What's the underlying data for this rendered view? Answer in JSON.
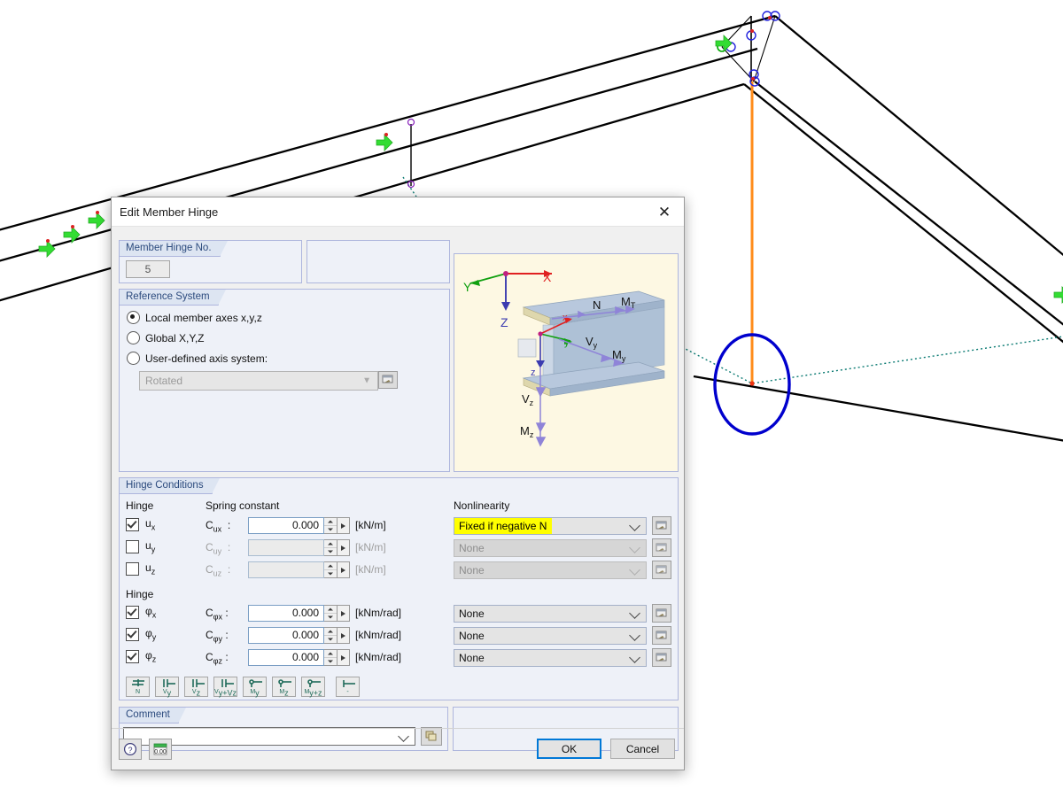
{
  "window": {
    "title": "Edit Member Hinge",
    "close_icon": "close-icon"
  },
  "hinge_no": {
    "group_label": "Member Hinge No.",
    "value": "5"
  },
  "reference_system": {
    "group_label": "Reference System",
    "options": [
      {
        "label": "Local member axes x,y,z",
        "selected": true
      },
      {
        "label": "Global X,Y,Z",
        "selected": false
      },
      {
        "label": "User-defined axis system:",
        "selected": false
      }
    ],
    "axis_select_value": "Rotated",
    "axis_select_button_icon": "edit-axis-icon"
  },
  "diagram": {
    "global_axes": [
      "X",
      "Y",
      "Z"
    ],
    "local_axes": [
      "x",
      "y",
      "z"
    ],
    "force_labels": [
      "N",
      "M_T",
      "V_y",
      "M_y",
      "V_z",
      "M_z"
    ],
    "n_label": "N",
    "mt_label": "M",
    "mt_sub": "T",
    "vy_label": "V",
    "vy_sub": "y",
    "my_label": "M",
    "my_sub": "y",
    "vz_label": "V",
    "vz_sub": "z",
    "mz_label": "M",
    "mz_sub": "z",
    "gx": "X",
    "gy": "Y",
    "gz": "Z",
    "lx": "x",
    "ly": "y",
    "lz": "z"
  },
  "hinge_conditions": {
    "group_label": "Hinge Conditions",
    "col_hinge": "Hinge",
    "col_spring": "Spring constant",
    "col_nonlinearity": "Nonlinearity",
    "col_hinge2": "Hinge",
    "translational": [
      {
        "dof": "u",
        "dof_sub": "x",
        "checked": true,
        "enabled": true,
        "constant": "C",
        "constant_sub": "ux",
        "colon": ":",
        "value": "0.000",
        "unit": "[kN/m]",
        "nonlinearity": "Fixed if negative N",
        "highlighted": true
      },
      {
        "dof": "u",
        "dof_sub": "y",
        "checked": false,
        "enabled": false,
        "constant": "C",
        "constant_sub": "uy",
        "colon": ":",
        "value": "",
        "unit": "[kN/m]",
        "nonlinearity": "None",
        "highlighted": false
      },
      {
        "dof": "u",
        "dof_sub": "z",
        "checked": false,
        "enabled": false,
        "constant": "C",
        "constant_sub": "uz",
        "colon": ":",
        "value": "",
        "unit": "[kN/m]",
        "nonlinearity": "None",
        "highlighted": false
      }
    ],
    "rotational": [
      {
        "dof": "φ",
        "dof_sub": "x",
        "checked": true,
        "enabled": true,
        "constant": "C",
        "constant_sub": "φx",
        "colon": ":",
        "value": "0.000",
        "unit": "[kNm/rad]",
        "nonlinearity": "None",
        "highlighted": false
      },
      {
        "dof": "φ",
        "dof_sub": "y",
        "checked": true,
        "enabled": true,
        "constant": "C",
        "constant_sub": "φy",
        "colon": ":",
        "value": "0.000",
        "unit": "[kNm/rad]",
        "nonlinearity": "None",
        "highlighted": false
      },
      {
        "dof": "φ",
        "dof_sub": "z",
        "checked": true,
        "enabled": true,
        "constant": "C",
        "constant_sub": "φz",
        "colon": ":",
        "value": "0.000",
        "unit": "[kNm/rad]",
        "nonlinearity": "None",
        "highlighted": false
      }
    ],
    "nonlinearity_button_icon": "edit-nonlinearity-icon"
  },
  "hinge_type_buttons": [
    {
      "label": "N",
      "name": "hinge-type-n"
    },
    {
      "label": "V",
      "sub": "y",
      "name": "hinge-type-vy"
    },
    {
      "label": "V",
      "sub": "z",
      "name": "hinge-type-vz"
    },
    {
      "label": "V",
      "sub": "y+Vz",
      "name": "hinge-type-vy-vz"
    },
    {
      "label": "M",
      "sub": "y",
      "name": "hinge-type-my"
    },
    {
      "label": "M",
      "sub": "z",
      "name": "hinge-type-mz"
    },
    {
      "label": "M",
      "sub": "y+z",
      "name": "hinge-type-my-mz"
    },
    {
      "label": "-",
      "name": "hinge-type-none"
    }
  ],
  "comment": {
    "group_label": "Comment",
    "value": "",
    "picker_icon": "comment-library-icon"
  },
  "footer": {
    "help_icon": "help-icon",
    "units_icon": "units-icon",
    "units_label": "0.00",
    "ok_label": "OK",
    "cancel_label": "Cancel"
  },
  "colors": {
    "highlight": "#ffff00",
    "accent": "#0078d7",
    "group_header_text": "#2b4a7d",
    "panel": "#eef1f8",
    "annotation_ellipse": "#0000cd",
    "member_orange": "#ff8c1a",
    "support_green": "#33dd33",
    "dashed_teal": "#0a7a72"
  }
}
